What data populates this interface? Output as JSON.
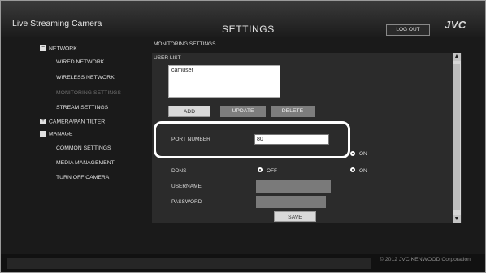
{
  "header": {
    "app_title": "Live Streaming Camera",
    "settings_title": "SETTINGS",
    "logout_label": "LOG OUT",
    "brand": "JVC"
  },
  "sidebar": {
    "network": "NETWORK",
    "wired_network": "WIRED NETWORK",
    "wireless_network": "WIRELESS NETWORK",
    "monitoring_settings": "MONITORING SETTINGS",
    "stream_settings": "STREAM SETTINGS",
    "camera_pan_tilter": "CAMERA/PAN TILTER",
    "manage": "MANAGE",
    "common_settings": "COMMON SETTINGS",
    "media_management": "MEDIA MANAGEMENT",
    "turn_off_camera": "TURN OFF CAMERA"
  },
  "main": {
    "section_title": "MONITORING SETTINGS",
    "user_list_label": "USER LIST",
    "users": [
      "camuser"
    ],
    "add_label": "ADD",
    "update_label": "UPDATE",
    "delete_label": "DELETE",
    "port_number_label": "PORT NUMBER",
    "port_number_value": "80",
    "on_label": "ON",
    "ddns_label": "DDNS",
    "ddns_off_label": "OFF",
    "ddns_on_label": "ON",
    "ddns_selected": "OFF",
    "username_label": "USERNAME",
    "password_label": "PASSWORD",
    "save_label": "SAVE"
  },
  "footer": {
    "copyright": "© 2012 JVC KENWOOD Corporation"
  },
  "icons": {
    "scroll_up": "scroll-up-arrow",
    "scroll_down": "scroll-down-arrow"
  }
}
